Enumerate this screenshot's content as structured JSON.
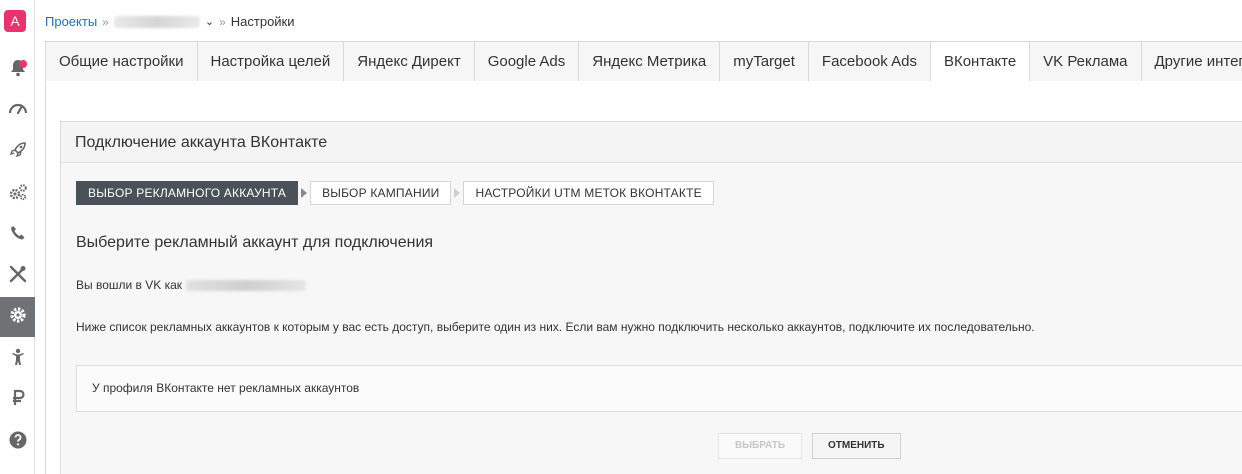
{
  "sidebar": {
    "logo_letter": "A",
    "items": [
      {
        "icon": "bell-icon"
      },
      {
        "icon": "speedometer-icon"
      },
      {
        "icon": "rocket-icon"
      },
      {
        "icon": "gears-icon"
      },
      {
        "icon": "phone-icon"
      },
      {
        "icon": "tools-icon"
      },
      {
        "icon": "settings-icon",
        "active": true
      },
      {
        "icon": "person-icon"
      },
      {
        "icon": "ruble-icon"
      },
      {
        "icon": "help-icon"
      }
    ],
    "colors": {
      "accent": "#e8336e",
      "active_bg": "#6f7275",
      "icon": "#666666"
    }
  },
  "breadcrumb": {
    "projects": "Проекты",
    "current": "Настройки"
  },
  "tabs": [
    {
      "label": "Общие настройки"
    },
    {
      "label": "Настройка целей"
    },
    {
      "label": "Яндекс Директ"
    },
    {
      "label": "Google Ads"
    },
    {
      "label": "Яндекс Метрика"
    },
    {
      "label": "myTarget"
    },
    {
      "label": "Facebook Ads"
    },
    {
      "label": "ВКонтакте",
      "active": true
    },
    {
      "label": "VK Реклама"
    },
    {
      "label": "Другие интеграции"
    }
  ],
  "panel": {
    "title": "Подключение аккаунта ВКонтакте",
    "steps": [
      {
        "label": "Выбор рекламного аккаунта",
        "active": true
      },
      {
        "label": "Выбор кампании"
      },
      {
        "label": "Настройки UTM меток ВКонтакте"
      }
    ],
    "section_title": "Выберите рекламный аккаунт для подключения",
    "logged_in_prefix": "Вы вошли в VK как",
    "hint": "Ниже список рекламных аккаунтов к которым у вас есть доступ, выберите один из них. Если вам нужно подключить несколько аккаунтов, подключите их последовательно.",
    "empty_message": "У профиля ВКонтакте нет рекламных аккаунтов",
    "select_button": "Выбрать",
    "cancel_button": "Отменить"
  }
}
